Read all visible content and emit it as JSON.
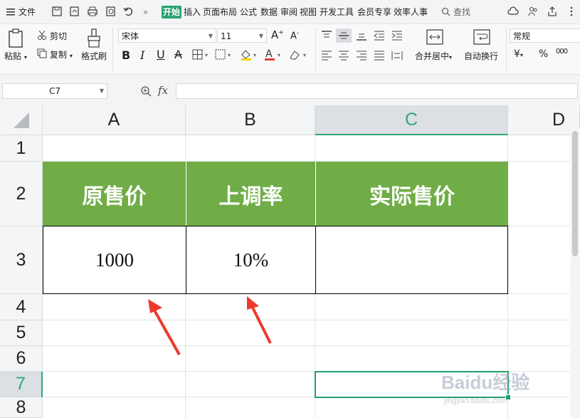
{
  "menubar": {
    "file_label": "文件",
    "tabs": [
      {
        "label": "开始",
        "active": true
      },
      {
        "label": "插入",
        "active": false
      },
      {
        "label": "页面布局",
        "active": false
      },
      {
        "label": "公式",
        "active": false
      },
      {
        "label": "数据",
        "active": false
      },
      {
        "label": "审阅",
        "active": false
      },
      {
        "label": "视图",
        "active": false
      },
      {
        "label": "开发工具",
        "active": false
      },
      {
        "label": "会员专享",
        "active": false
      },
      {
        "label": "效率人事",
        "active": false
      }
    ],
    "search_label": "查找",
    "more_label": "»"
  },
  "ribbon": {
    "paste_label": "粘贴",
    "cut_label": "剪切",
    "copy_label": "复制",
    "format_painter_label": "格式刷",
    "font_name": "宋体",
    "font_size": "11",
    "merge_center_label": "合并居中",
    "wrap_text_label": "自动换行",
    "number_format": "常规",
    "currency_symbol": "¥",
    "percent_symbol": "%",
    "thousands_symbol": "000"
  },
  "formula_bar": {
    "name_box": "C7",
    "fx_label": "fx",
    "formula": ""
  },
  "sheet": {
    "columns": [
      "A",
      "B",
      "C",
      "D"
    ],
    "rows": [
      "1",
      "2",
      "3",
      "4",
      "5",
      "6",
      "7",
      "8"
    ],
    "header_row": [
      "原售价",
      "上调率",
      "实际售价"
    ],
    "data_row": [
      "1000",
      "10%",
      ""
    ],
    "selected_cell": "C7"
  },
  "colors": {
    "accent": "#27a36d",
    "header_fill": "#70ad47",
    "selection": "#1f9f6b",
    "arrow": "#ee3a2c"
  },
  "watermark": {
    "text": "Baidu经验",
    "subtext": "jingyan.baidu.com"
  }
}
